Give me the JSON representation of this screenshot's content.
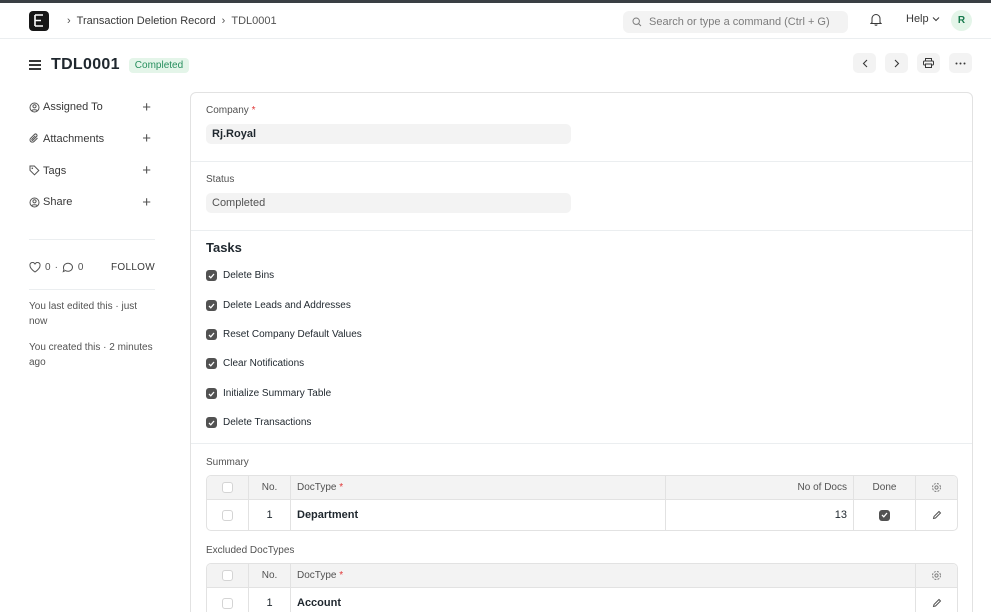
{
  "navbar": {
    "breadcrumb": [
      "Transaction Deletion Record",
      "TDL0001"
    ],
    "search_placeholder": "Search or type a command (Ctrl + G)",
    "help_label": "Help",
    "avatar_letter": "R"
  },
  "page": {
    "title": "TDL0001",
    "status_badge": "Completed"
  },
  "sidebar": {
    "items": [
      {
        "label": "Assigned To"
      },
      {
        "label": "Attachments"
      },
      {
        "label": "Tags"
      },
      {
        "label": "Share"
      }
    ],
    "likes": "0",
    "comments": "0",
    "dot": "·",
    "follow_label": "FOLLOW",
    "activity": [
      "You last edited this · just now",
      "You created this · 2 minutes ago"
    ]
  },
  "form": {
    "company_label": "Company",
    "required_mark": "*",
    "company_value": "Rj.Royal",
    "status_label": "Status",
    "status_value": "Completed",
    "tasks_title": "Tasks",
    "tasks": [
      "Delete Bins",
      "Delete Leads and Addresses",
      "Reset Company Default Values",
      "Clear Notifications",
      "Initialize Summary Table",
      "Delete Transactions"
    ],
    "summary_label": "Summary",
    "summary_headers": {
      "no": "No.",
      "doctype": "DocType",
      "no_of_docs": "No of Docs",
      "done": "Done"
    },
    "summary_rows": [
      {
        "no": "1",
        "doctype": "Department",
        "no_of_docs": "13",
        "done": true
      }
    ],
    "excluded_label": "Excluded DocTypes",
    "excluded_headers": {
      "no": "No.",
      "doctype": "DocType"
    },
    "excluded_rows": [
      {
        "no": "1",
        "doctype": "Account"
      }
    ]
  },
  "colors": {
    "accent_green": "#278f5e",
    "badge_bg": "#e4f5e9",
    "required": "#e03636"
  }
}
